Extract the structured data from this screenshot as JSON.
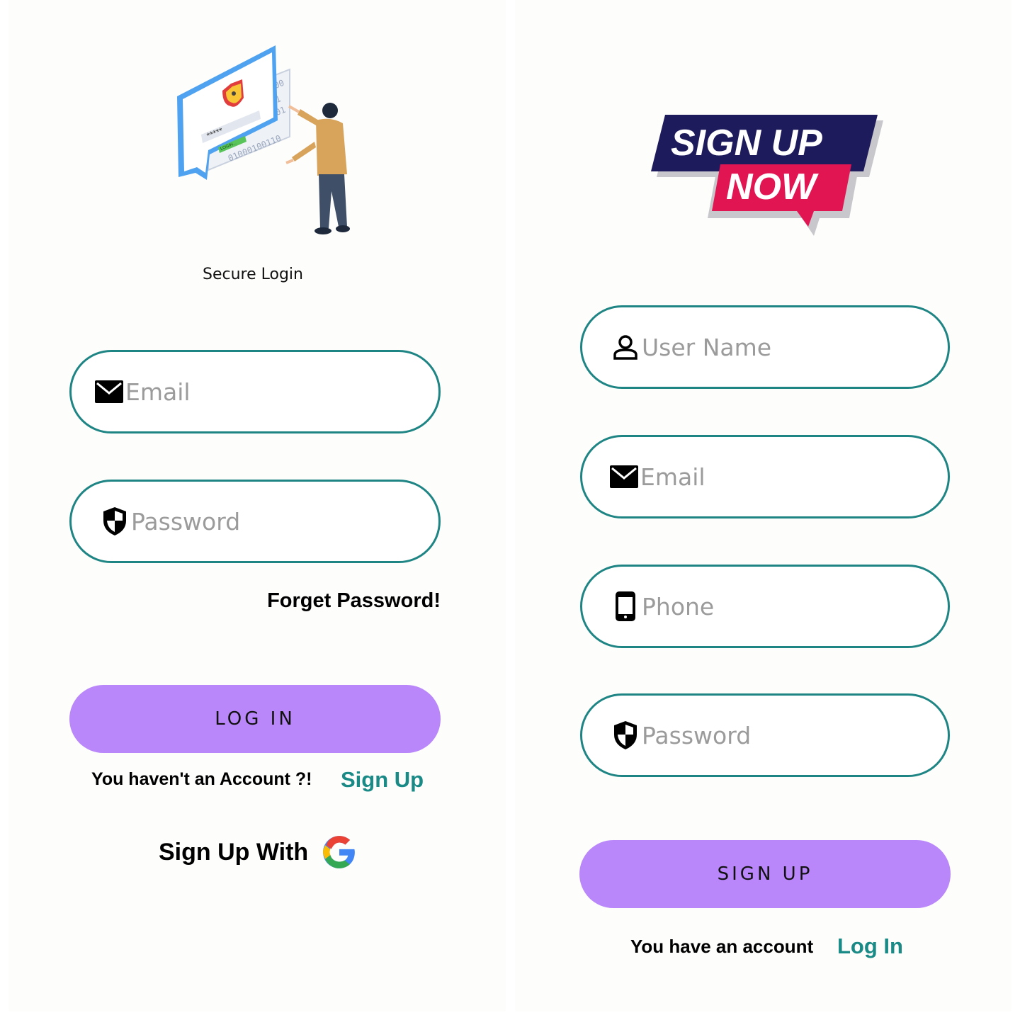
{
  "login": {
    "illustration_caption": "Secure Login",
    "illustration_screen_text": "LOGIN...",
    "email_placeholder": "Email",
    "password_placeholder": "Password",
    "forgot_password": "Forget Password!",
    "login_button": "LOG IN",
    "no_account_text": "You haven't an Account ?!",
    "signup_link": "Sign Up",
    "signup_with": "Sign Up With",
    "google_icon": "google-icon"
  },
  "signup": {
    "logo_line1": "SIGN UP",
    "logo_line2": "NOW",
    "username_placeholder": "User Name",
    "email_placeholder": "Email",
    "phone_placeholder": "Phone",
    "password_placeholder": "Password",
    "signup_button": "SIGN UP",
    "have_account_text": "You have an account",
    "login_link": "Log In"
  },
  "colors": {
    "accent_teal": "#1f8584",
    "button_purple": "#b987f9",
    "logo_navy": "#1e1b5c",
    "logo_red": "#e21553"
  }
}
